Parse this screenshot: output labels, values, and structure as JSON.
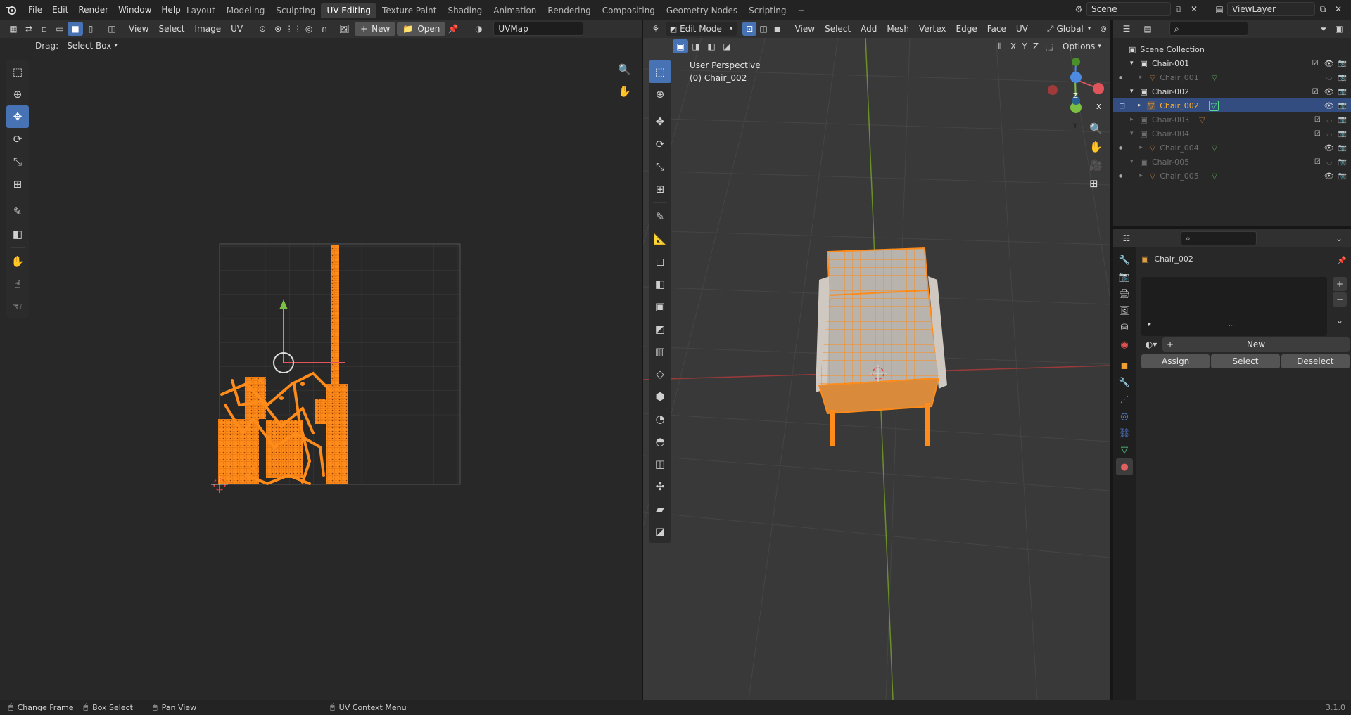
{
  "app": {
    "menus": [
      "File",
      "Edit",
      "Render",
      "Window",
      "Help"
    ],
    "workspaces": [
      "Layout",
      "Modeling",
      "Sculpting",
      "UV Editing",
      "Texture Paint",
      "Shading",
      "Animation",
      "Rendering",
      "Compositing",
      "Geometry Nodes",
      "Scripting"
    ],
    "active_workspace": "UV Editing",
    "add_workspace": "+",
    "scene_name": "Scene",
    "viewlayer_name": "ViewLayer"
  },
  "uv_editor": {
    "menus": [
      "View",
      "Select",
      "Image",
      "UV"
    ],
    "new_label": "New",
    "open_label": "Open",
    "uvmap_name": "UVMap",
    "drag_label": "Drag:",
    "drag_value": "Select Box"
  },
  "viewport": {
    "mode": "Edit Mode",
    "menus": [
      "View",
      "Select",
      "Add",
      "Mesh",
      "Vertex",
      "Edge",
      "Face",
      "UV"
    ],
    "orientation": "Global",
    "options_label": "Options",
    "perspective_label": "User Perspective",
    "object_label": "(0) Chair_002",
    "axis_toggles": [
      "X",
      "Y",
      "Z"
    ],
    "gizmo_axes": [
      "X",
      "Y",
      "Z"
    ]
  },
  "outliner": {
    "root": "Scene Collection",
    "rows": [
      {
        "name": "Chair-001",
        "type": "collection",
        "dim": false,
        "selected": false
      },
      {
        "name": "Chair_001",
        "type": "object",
        "dim": true,
        "selected": false
      },
      {
        "name": "Chair-002",
        "type": "collection",
        "dim": false,
        "selected": false
      },
      {
        "name": "Chair_002",
        "type": "object",
        "dim": false,
        "selected": true
      },
      {
        "name": "Chair-003",
        "type": "collection",
        "dim": true,
        "selected": false
      },
      {
        "name": "Chair-004",
        "type": "collection",
        "dim": true,
        "selected": false
      },
      {
        "name": "Chair_004",
        "type": "object",
        "dim": true,
        "selected": false
      },
      {
        "name": "Chair-005",
        "type": "collection",
        "dim": true,
        "selected": false
      },
      {
        "name": "Chair_005",
        "type": "object",
        "dim": true,
        "selected": false
      }
    ]
  },
  "properties": {
    "object_name": "Chair_002",
    "new_label": "New",
    "assign_label": "Assign",
    "select_label": "Select",
    "deselect_label": "Deselect",
    "add_slot": "+",
    "remove_slot": "−"
  },
  "statusbar": {
    "change_frame": "Change Frame",
    "box_select": "Box Select",
    "pan_view": "Pan View",
    "uv_context_menu": "UV Context Menu",
    "version": "3.1.0"
  },
  "colors": {
    "accent": "#4772b3",
    "mesh_orange": "#ff8c1a",
    "bg_editor": "#282828",
    "header": "#303030"
  }
}
